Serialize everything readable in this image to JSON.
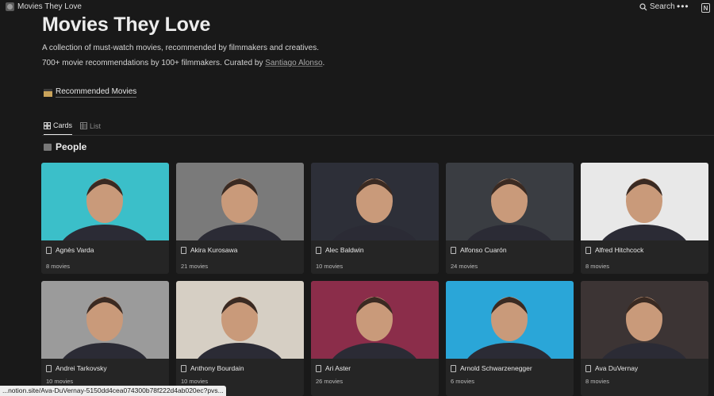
{
  "topbar": {
    "breadcrumb": "Movies They Love",
    "search_label": "Search",
    "more_label": "•••",
    "notion_label": "N"
  },
  "page": {
    "title": "Movies They Love",
    "description_1": "A collection of must-watch movies, recommended by filmmakers and creatives.",
    "description_2_prefix": "700+ movie recommendations by 100+ filmmakers. Curated by ",
    "curator_name": "Santiago Alonso",
    "description_2_suffix": "."
  },
  "recommended_link": {
    "label": "Recommended Movies",
    "icon": "clapperboard-icon"
  },
  "tabs": [
    {
      "label": "Cards",
      "icon": "grid-icon",
      "active": true
    },
    {
      "label": "List",
      "icon": "table-icon",
      "active": false
    }
  ],
  "section": {
    "title": "People",
    "icon": "clapper-icon"
  },
  "people": [
    {
      "name": "Agnès Varda",
      "count": "8 movies",
      "bg": "#3bbfc9"
    },
    {
      "name": "Akira Kurosawa",
      "count": "21 movies",
      "bg": "#7a7a7a"
    },
    {
      "name": "Alec Baldwin",
      "count": "10 movies",
      "bg": "#2d2f38"
    },
    {
      "name": "Alfonso Cuarón",
      "count": "24 movies",
      "bg": "#3a3d42"
    },
    {
      "name": "Alfred Hitchcock",
      "count": "8 movies",
      "bg": "#e8e8e8"
    },
    {
      "name": "Andrei Tarkovsky",
      "count": "10 movies",
      "bg": "#9b9b9b"
    },
    {
      "name": "Anthony Bourdain",
      "count": "10 movies",
      "bg": "#d6cfc4"
    },
    {
      "name": "Ari Aster",
      "count": "26 movies",
      "bg": "#8b2d4a"
    },
    {
      "name": "Arnold Schwarzenegger",
      "count": "6 movies",
      "bg": "#2aa6d8"
    },
    {
      "name": "Ava DuVernay",
      "count": "8 movies",
      "bg": "#3c3434"
    }
  ],
  "status_bar": {
    "url": "...notion.site/Ava-DuVernay-5150dd4cea074300b78f222d4ab020ec?pvs..."
  }
}
